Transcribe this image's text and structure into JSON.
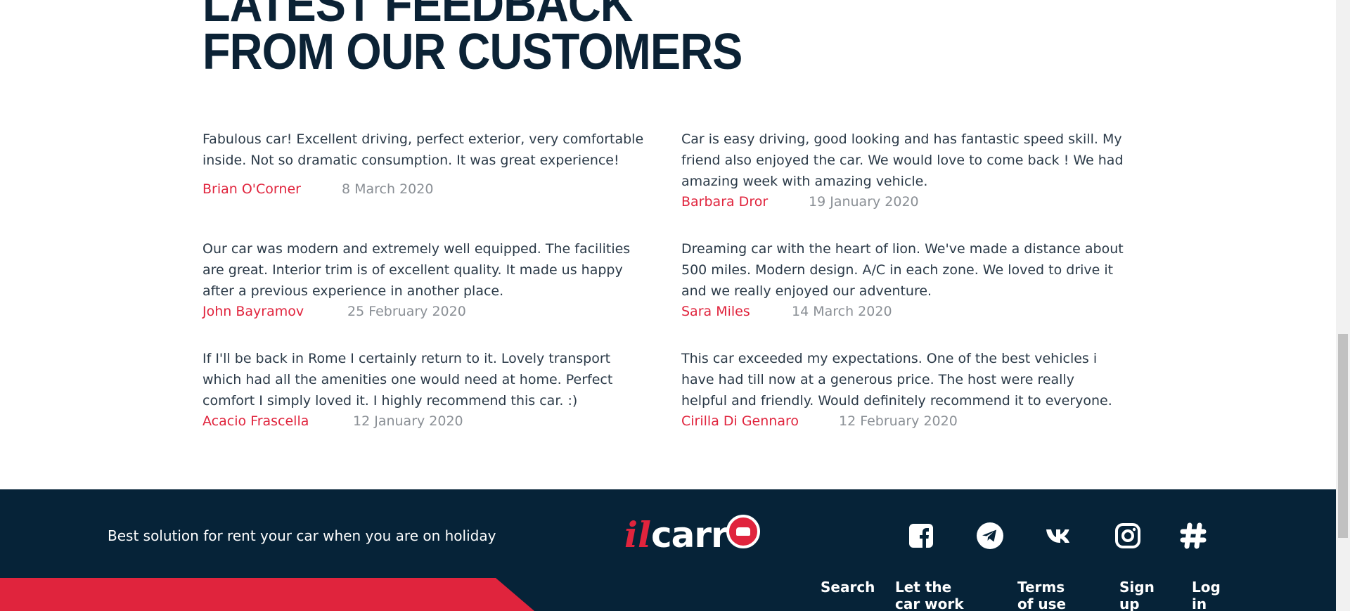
{
  "heading": {
    "line1": "Latest feedback",
    "line2": "from our customers"
  },
  "reviews": [
    {
      "text": "Fabulous car! Excellent driving, perfect exterior, very comfortable inside. Not so dramatic consumption. It was great experience!",
      "author": "Brian O'Corner",
      "date": "8 March 2020"
    },
    {
      "text": "Car is easy driving, good looking and has fantastic speed skill. My friend also enjoyed the car. We would love to come back ! We had amazing week with amazing vehicle.",
      "author": "Barbara Dror",
      "date": "19 January 2020"
    },
    {
      "text": "Our car was modern and extremely well equipped. The facilities are great. Interior trim is of excellent quality. It made us happy after a previous experience in another place.",
      "author": "John Bayramov",
      "date": "25 February 2020"
    },
    {
      "text": "Dreaming car with the heart of lion. We've made a distance about 500 miles. Modern design. A/C in each zone. We loved to drive it and we really enjoyed our adventure.",
      "author": "Sara Miles",
      "date": "14 March 2020"
    },
    {
      "text": "If I'll be back in Rome I certainly return to it. Lovely transport which had all the amenities one would need at home. Perfect comfort I simply loved it. I highly recommend this car. :)",
      "author": "Acacio Frascella",
      "date": "12 January 2020"
    },
    {
      "text": "This car exceeded my expectations. One of the best vehicles i have had till now at a generous price. The host were really helpful and friendly. Would definitely recommend it to everyone.",
      "author": "Cirilla Di Gennaro",
      "date": "12 February 2020"
    }
  ],
  "footer": {
    "slogan": "Best solution for rent your car when you are on holiday",
    "logo": {
      "il": "il",
      "carro": "carr"
    },
    "social_icons": [
      "facebook-icon",
      "telegram-icon",
      "vk-icon",
      "instagram-icon",
      "slack-icon"
    ],
    "nav": {
      "search": "Search",
      "let_car_work": "Let the car work",
      "terms": "Terms of use",
      "signup": "Sign up",
      "login": "Log in"
    }
  },
  "colors": {
    "accent": "#e0243d",
    "dark": "#062338",
    "date": "#8a8f95"
  }
}
